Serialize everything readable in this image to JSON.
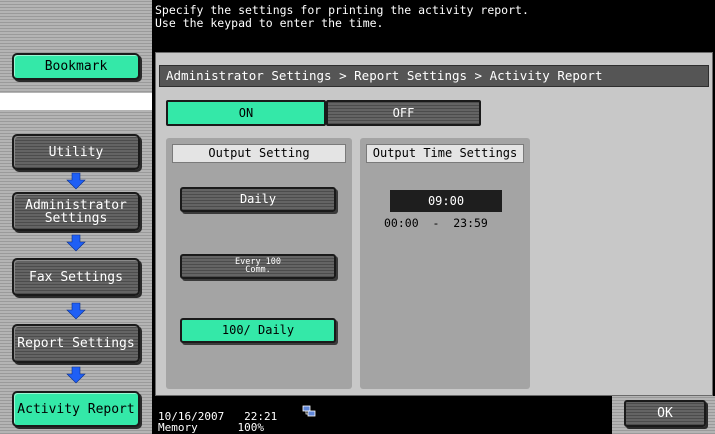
{
  "header": {
    "message": "Specify the settings for printing the activity report.\nUse the keypad to enter the time."
  },
  "sidebar": {
    "bookmark_label": "Bookmark",
    "items": [
      {
        "label": "Utility"
      },
      {
        "label": "Administrator\nSettings"
      },
      {
        "label": "Fax Settings"
      },
      {
        "label": "Report Settings"
      },
      {
        "label": "Activity Report",
        "selected": true
      }
    ]
  },
  "breadcrumb": "Administrator Settings > Report Settings > Activity Report",
  "toggle": {
    "on_label": "ON",
    "off_label": "OFF",
    "selected": "ON"
  },
  "output_setting": {
    "title": "Output Setting",
    "options": [
      {
        "label": "Daily",
        "selected": false
      },
      {
        "label": "Every 100\nComm.",
        "selected": false
      },
      {
        "label": "100/ Daily",
        "selected": true
      }
    ]
  },
  "output_time": {
    "title": "Output Time Settings",
    "value": "09:00",
    "range": "00:00  -  23:59"
  },
  "status": {
    "date_time": "10/16/2007   22:21",
    "memory": "Memory      100%",
    "network_icon": "network-icon"
  },
  "ok_label": "OK",
  "colors": {
    "accent_green": "#34e8a8",
    "panel_gray": "#c8c8c8",
    "button_dark": "#555555"
  }
}
